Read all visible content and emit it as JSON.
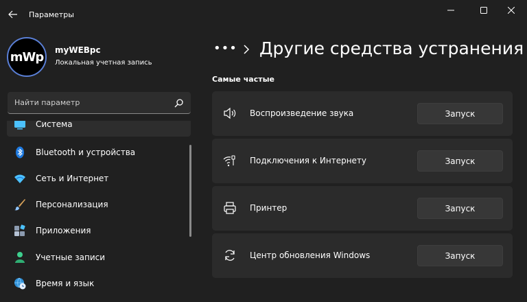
{
  "window": {
    "title": "Параметры"
  },
  "profile": {
    "avatar_text": "mWp",
    "name": "myWEBpc",
    "account_type": "Локальная учетная запись"
  },
  "search": {
    "placeholder": "Найти параметр"
  },
  "sidebar": {
    "items": [
      {
        "label": "Система",
        "icon": "system-icon",
        "active": true
      },
      {
        "label": "Bluetooth и устройства",
        "icon": "bluetooth-icon"
      },
      {
        "label": "Сеть и Интернет",
        "icon": "wifi-icon"
      },
      {
        "label": "Персонализация",
        "icon": "brush-icon"
      },
      {
        "label": "Приложения",
        "icon": "apps-icon"
      },
      {
        "label": "Учетные записи",
        "icon": "user-icon"
      },
      {
        "label": "Время и язык",
        "icon": "globe-clock-icon"
      }
    ]
  },
  "breadcrumb": {
    "dots": "•••",
    "title": "Другие средства устранения"
  },
  "section": {
    "title": "Самые частые"
  },
  "troubleshooters": [
    {
      "label": "Воспроизведение звука",
      "icon": "speaker-icon",
      "button": "Запуск"
    },
    {
      "label": "Подключения к Интернету",
      "icon": "network-icon",
      "button": "Запуск"
    },
    {
      "label": "Принтер",
      "icon": "printer-icon",
      "button": "Запуск"
    },
    {
      "label": "Центр обновления Windows",
      "icon": "update-icon",
      "button": "Запуск"
    }
  ],
  "colors": {
    "background": "#202020",
    "card": "#2b2b2b",
    "button": "#373737",
    "accent": "#4cc2ff"
  }
}
